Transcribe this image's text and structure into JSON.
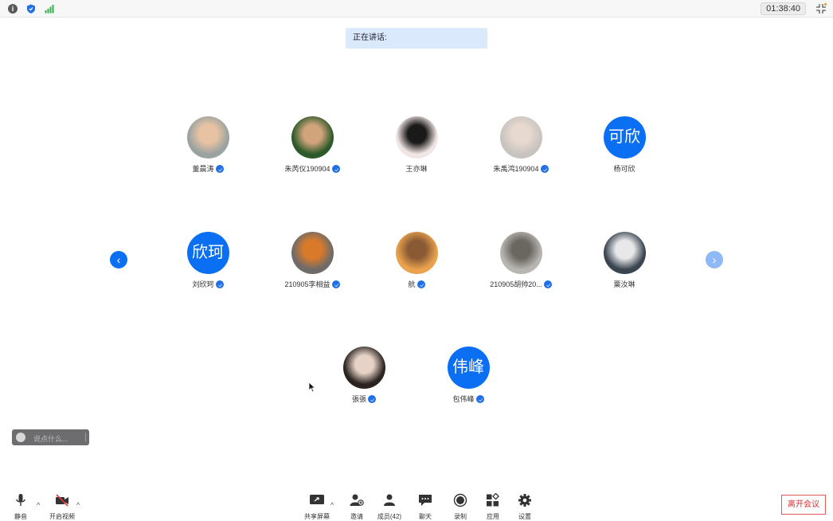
{
  "topbar": {
    "timer": "01:38:40"
  },
  "speaking": {
    "label": "正在讲话:"
  },
  "participants": [
    {
      "name": "董晨涛",
      "avatar_type": "photo",
      "photo_colors": [
        "#9aa3a0",
        "#e8c3a3"
      ],
      "badge": true
    },
    {
      "name": "朱芮仪190904",
      "avatar_type": "photo",
      "photo_colors": [
        "#2d5a2a",
        "#d2a47c"
      ],
      "badge": true
    },
    {
      "name": "王亦琳",
      "avatar_type": "photo",
      "photo_colors": [
        "#f0e6e4",
        "#1a1a1a"
      ],
      "badge": false
    },
    {
      "name": "朱禹鸿190904",
      "avatar_type": "photo",
      "photo_colors": [
        "#c9c3c0",
        "#e7d9cf"
      ],
      "badge": true
    },
    {
      "name": "杨可欣",
      "avatar_type": "text",
      "initials": "可欣",
      "badge": false
    },
    {
      "name": "刘欣珂",
      "avatar_type": "text",
      "initials": "欣珂",
      "badge": true
    },
    {
      "name": "210905李相益",
      "avatar_type": "photo",
      "photo_colors": [
        "#6e6b68",
        "#d97a2b"
      ],
      "badge": true
    },
    {
      "name": "航",
      "avatar_type": "photo",
      "photo_colors": [
        "#e9a24d",
        "#8a5a34"
      ],
      "badge": true
    },
    {
      "name": "210905胡帅20...",
      "avatar_type": "photo",
      "photo_colors": [
        "#b8b6b2",
        "#6a6660"
      ],
      "badge": true
    },
    {
      "name": "粟汝琳",
      "avatar_type": "photo",
      "photo_colors": [
        "#3a4550",
        "#e8e8ea"
      ],
      "badge": false
    },
    {
      "name": "張張",
      "avatar_type": "photo",
      "photo_colors": [
        "#2a2320",
        "#e6d2c6"
      ],
      "badge": true
    },
    {
      "name": "包伟峰",
      "avatar_type": "text",
      "initials": "伟峰",
      "badge": true
    }
  ],
  "chat": {
    "placeholder": "说点什么..."
  },
  "toolbar": {
    "mute": "静音",
    "video": "开启视频",
    "share": "共享屏幕",
    "invite": "邀请",
    "members": "成员(42)",
    "chat": "聊天",
    "record": "录制",
    "apps": "应用",
    "settings": "设置",
    "leave": "离开会议"
  },
  "colors": {
    "accent": "#0b6ff4",
    "speaking_bg": "#dbe9fc",
    "leave_red": "#d83030"
  }
}
